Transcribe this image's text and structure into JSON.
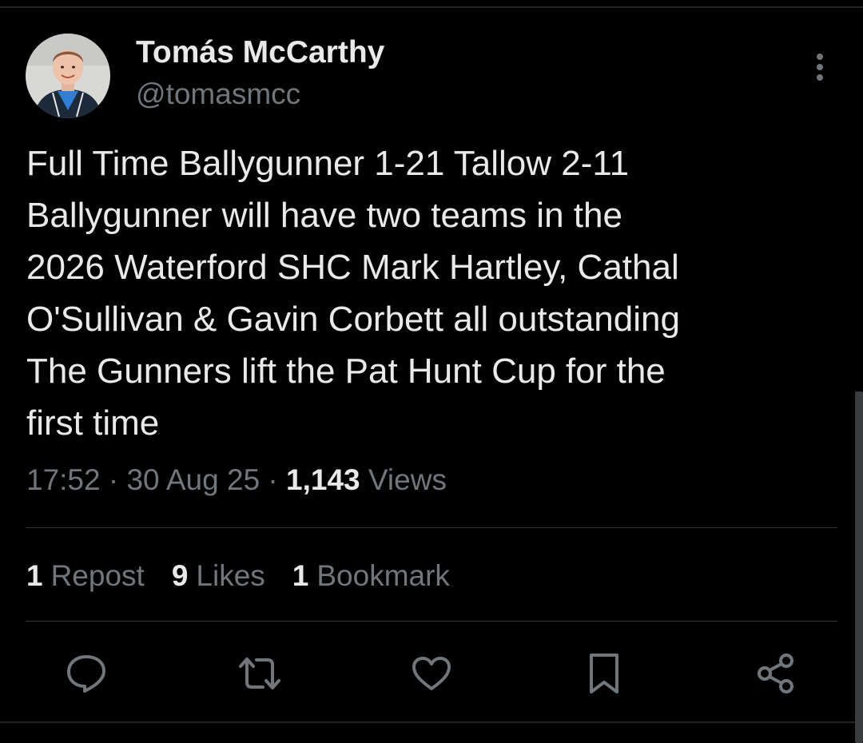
{
  "author": {
    "name": "Tomás McCarthy",
    "handle": "@tomasmcc",
    "avatar_icon": "profile-photo"
  },
  "tweet": {
    "lines": [
      "Full Time Ballygunner 1-21 Tallow 2-11",
      "Ballygunner will have two teams in the",
      "2026 Waterford SHC Mark Hartley, Cathal",
      "O'Sullivan & Gavin Corbett all outstanding",
      "The Gunners lift the Pat Hunt Cup for the",
      "first time"
    ]
  },
  "meta": {
    "time": "17:52",
    "separator": " · ",
    "date": "30 Aug 25",
    "views_count": "1,143",
    "views_label": "Views"
  },
  "stats": {
    "reposts_count": "1",
    "reposts_label": "Repost",
    "likes_count": "9",
    "likes_label": "Likes",
    "bookmarks_count": "1",
    "bookmarks_label": "Bookmark"
  },
  "actions": [
    {
      "icon": "reply-icon"
    },
    {
      "icon": "repost-icon"
    },
    {
      "icon": "like-icon"
    },
    {
      "icon": "bookmark-icon"
    },
    {
      "icon": "share-icon"
    }
  ],
  "colors": {
    "background": "#000000",
    "primary_text": "#e7e9ea",
    "secondary_text": "#71767b",
    "divider": "#2f3336"
  }
}
